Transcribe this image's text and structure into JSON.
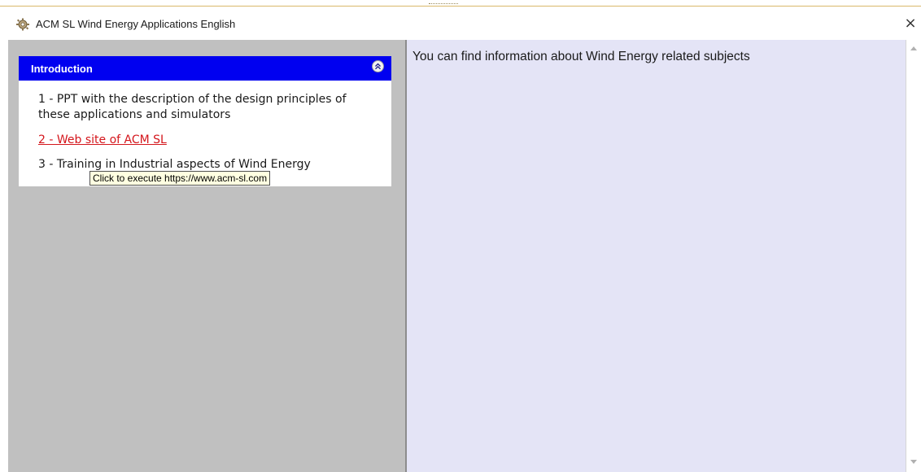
{
  "window": {
    "title": "ACM SL Wind Energy Applications English",
    "close_label": "×"
  },
  "panel": {
    "header": "Introduction",
    "items": [
      {
        "label": "1 - PPT with the description of the design principles of these applications and simulators"
      },
      {
        "label": "2 - Web site of ACM SL"
      },
      {
        "label": "3 - Training in Industrial aspects of Wind Energy"
      }
    ]
  },
  "tooltip": {
    "text": "Click to execute https://www.acm-sl.com"
  },
  "content": {
    "text": "You can find information about Wind Energy related subjects"
  },
  "icons": {
    "app": "gear-icon",
    "collapse": "double-chevron-up-icon",
    "scroll_up": "arrow-up-icon",
    "scroll_down": "arrow-down-icon",
    "close": "close-icon"
  },
  "colors": {
    "panel_header_bg": "#0000f0",
    "link": "#d4161c",
    "content_bg": "#e4e4f6",
    "left_pane_bg": "#c0c0c0",
    "tooltip_bg": "#ffffe1"
  }
}
